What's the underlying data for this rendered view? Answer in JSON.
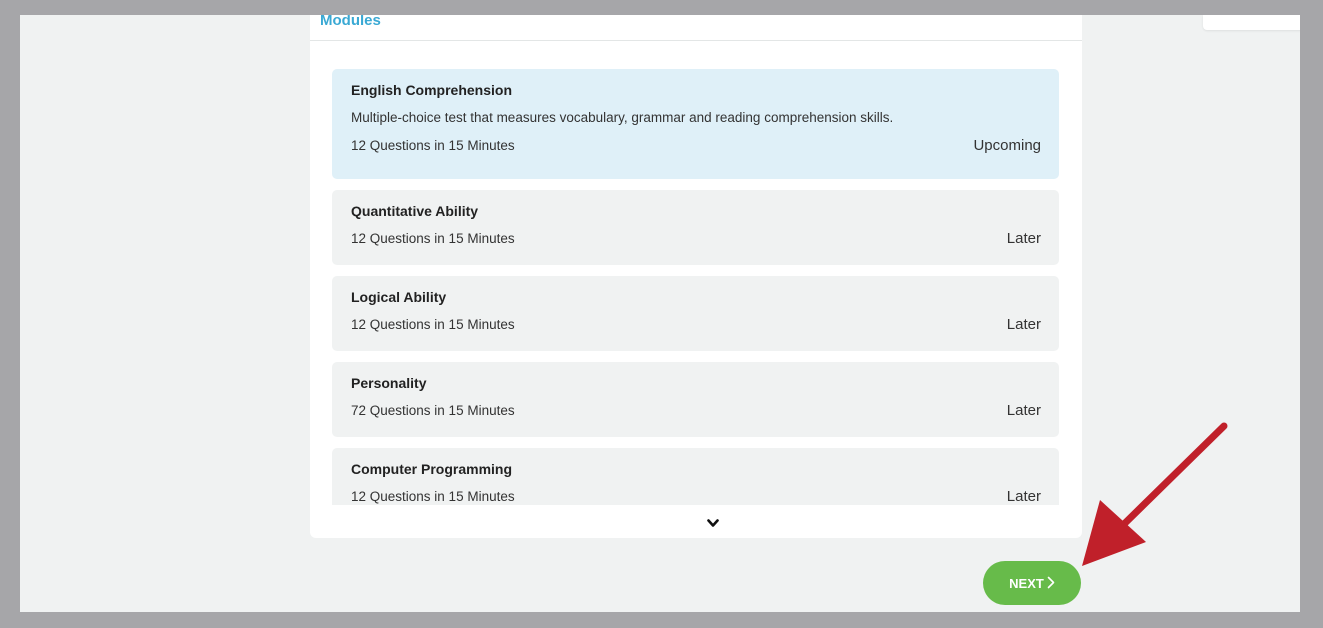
{
  "modules_panel": {
    "title": "Modules",
    "modules": [
      {
        "name": "English Comprehension",
        "description": "Multiple-choice test that measures vocabulary, grammar and reading comprehension skills.",
        "meta": "12 Questions in 15 Minutes",
        "status": "Upcoming"
      },
      {
        "name": "Quantitative Ability",
        "meta": "12 Questions in 15 Minutes",
        "status": "Later"
      },
      {
        "name": "Logical Ability",
        "meta": "12 Questions in 15 Minutes",
        "status": "Later"
      },
      {
        "name": "Personality",
        "meta": "72 Questions in 15 Minutes",
        "status": "Later"
      },
      {
        "name": "Computer Programming",
        "meta": "12 Questions in 15 Minutes",
        "status": "Later"
      }
    ],
    "scroll_icon": "chevron-down-icon"
  },
  "next_button": {
    "label": "NEXT",
    "icon": "chevron-right-icon"
  },
  "annotation": {
    "icon": "red-arrow-icon",
    "color": "#c0202a"
  },
  "colors": {
    "accent": "#3aa9d4",
    "active_module_bg": "#dff0f8",
    "next_button": "#67bb4a"
  }
}
